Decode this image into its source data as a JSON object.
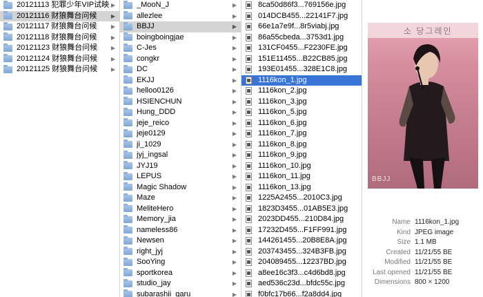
{
  "column1": {
    "items": [
      {
        "label": "20121113 犯罪少年VIP试映",
        "selected": false
      },
      {
        "label": "20121116 财狼舞台问候",
        "selected": true
      },
      {
        "label": "20121117 财狼舞台问候",
        "selected": false
      },
      {
        "label": "20121118 财狼舞台问候",
        "selected": false
      },
      {
        "label": "20121123 财狼舞台问候",
        "selected": false
      },
      {
        "label": "20121124 财狼舞台问候",
        "selected": false
      },
      {
        "label": "20121125 财狼舞台问候",
        "selected": false
      }
    ]
  },
  "column2": {
    "items": [
      {
        "label": "_MooN_J",
        "selected": false
      },
      {
        "label": "allezlee",
        "selected": false
      },
      {
        "label": "BBJJ",
        "selected": true
      },
      {
        "label": "boingboingjae",
        "selected": false
      },
      {
        "label": "C-Jes",
        "selected": false
      },
      {
        "label": "congkr",
        "selected": false
      },
      {
        "label": "DC",
        "selected": false
      },
      {
        "label": "EKJJ",
        "selected": false
      },
      {
        "label": "helloo0126",
        "selected": false
      },
      {
        "label": "HSIENCHUN",
        "selected": false
      },
      {
        "label": "Hung_DDD",
        "selected": false
      },
      {
        "label": "jeje_reico",
        "selected": false
      },
      {
        "label": "jeje0129",
        "selected": false
      },
      {
        "label": "ji_1029",
        "selected": false
      },
      {
        "label": "jyj_ingsal",
        "selected": false
      },
      {
        "label": "JYJ19",
        "selected": false
      },
      {
        "label": "LEPUS",
        "selected": false
      },
      {
        "label": "Magic Shadow",
        "selected": false
      },
      {
        "label": "Maze",
        "selected": false
      },
      {
        "label": "MeliteHero",
        "selected": false
      },
      {
        "label": "Memory_jia",
        "selected": false
      },
      {
        "label": "nameless86",
        "selected": false
      },
      {
        "label": "Newsen",
        "selected": false
      },
      {
        "label": "right_jyj",
        "selected": false
      },
      {
        "label": "SooYing",
        "selected": false
      },
      {
        "label": "sportkorea",
        "selected": false
      },
      {
        "label": "studio_jay",
        "selected": false
      },
      {
        "label": "subarashii_garu",
        "selected": false
      }
    ]
  },
  "column3": {
    "items": [
      {
        "label": "8ca50d86f3...769156e.jpg",
        "selected": false
      },
      {
        "label": "014DCB455...22141F7.jpg",
        "selected": false
      },
      {
        "label": "66e1a7e9f...8r5viabj.jpg",
        "selected": false
      },
      {
        "label": "86a55cbeda...3753d1.jpg",
        "selected": false
      },
      {
        "label": "131CF0455...F2230FE.jpg",
        "selected": false
      },
      {
        "label": "151E11455...B22CB85.jpg",
        "selected": false
      },
      {
        "label": "193E01455...328E1C8.jpg",
        "selected": false
      },
      {
        "label": "1116kon_1.jpg",
        "selected": true
      },
      {
        "label": "1116kon_2.jpg",
        "selected": false
      },
      {
        "label": "1116kon_3.jpg",
        "selected": false
      },
      {
        "label": "1116kon_5.jpg",
        "selected": false
      },
      {
        "label": "1116kon_6.jpg",
        "selected": false
      },
      {
        "label": "1116kon_7.jpg",
        "selected": false
      },
      {
        "label": "1116kon_8.jpg",
        "selected": false
      },
      {
        "label": "1116kon_9.jpg",
        "selected": false
      },
      {
        "label": "1116kon_10.jpg",
        "selected": false
      },
      {
        "label": "1116kon_11.jpg",
        "selected": false
      },
      {
        "label": "1116kon_13.jpg",
        "selected": false
      },
      {
        "label": "1225A2455...2010C3.jpg",
        "selected": false
      },
      {
        "label": "1823D3455...01AB5E3.jpg",
        "selected": false
      },
      {
        "label": "2023DD455...210D84.jpg",
        "selected": false
      },
      {
        "label": "17232D455...F1FF991.jpg",
        "selected": false
      },
      {
        "label": "144261455...20B8E8A.jpg",
        "selected": false
      },
      {
        "label": "203743455...324B3FB.jpg",
        "selected": false
      },
      {
        "label": "204089455...12237BD.jpg",
        "selected": false
      },
      {
        "label": "a8ee16c3f3...c4d6bd8.jpg",
        "selected": false
      },
      {
        "label": "aed536c23d...bfdc55c.jpg",
        "selected": false
      },
      {
        "label": "f0bfc17b66...f2a8dd4.jpg",
        "selected": false
      }
    ]
  },
  "preview": {
    "banner_text": "소 당그레인",
    "watermark": "BBJJ"
  },
  "info": {
    "rows": [
      {
        "key": "Name",
        "value": "1116kon_1.jpg"
      },
      {
        "key": "Kind",
        "value": "JPEG image"
      },
      {
        "key": "Size",
        "value": "1.1 MB"
      },
      {
        "key": "Created",
        "value": "11/21/55 BE"
      },
      {
        "key": "Modified",
        "value": "11/21/55 BE"
      },
      {
        "key": "Last opened",
        "value": "11/21/55 BE"
      },
      {
        "key": "Dimensions",
        "value": "800 × 1200"
      }
    ]
  },
  "colors": {
    "selection_active": "#3875d7",
    "selection_inactive": "#d4d4d4",
    "folder": "#7ea7d8"
  }
}
